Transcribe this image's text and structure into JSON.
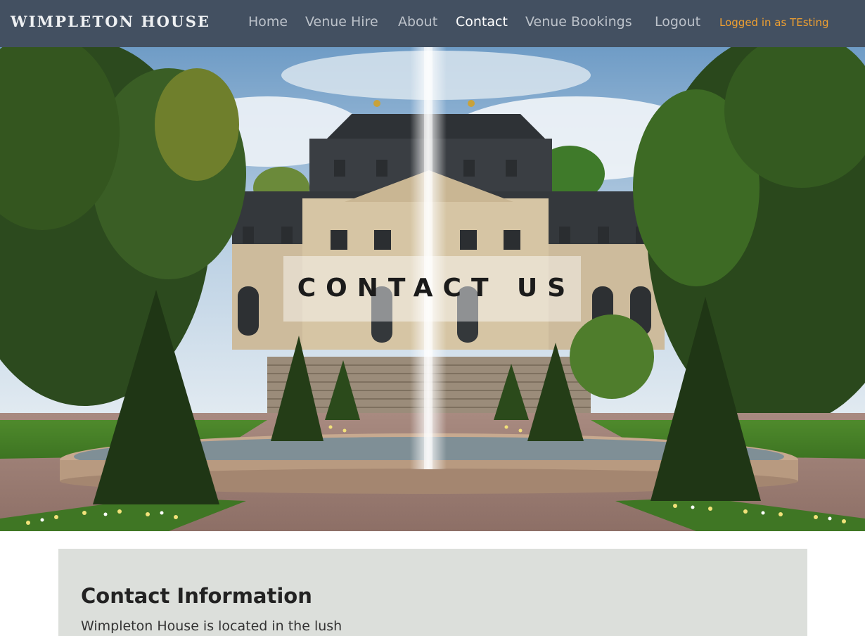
{
  "navbar": {
    "brand": "WIMPLETON HOUSE",
    "links": [
      {
        "label": "Home",
        "active": false
      },
      {
        "label": "Venue Hire",
        "active": false
      },
      {
        "label": "About",
        "active": false
      },
      {
        "label": "Contact",
        "active": true
      },
      {
        "label": "Venue Bookings",
        "active": false
      },
      {
        "label": "Logout",
        "active": false
      }
    ],
    "status": "Logged in as TEsting"
  },
  "hero": {
    "title": "CONTACT US",
    "image": "palace-with-fountain-and-topiary-garden"
  },
  "content": {
    "heading": "Contact Information",
    "text": "Wimpleton House is located in the lush"
  },
  "colors": {
    "navbar_bg": "#435061",
    "nav_link": "#bcc2ca",
    "nav_active": "#ffffff",
    "status_accent": "#f0a030",
    "content_card_bg": "#dcdfdb"
  }
}
